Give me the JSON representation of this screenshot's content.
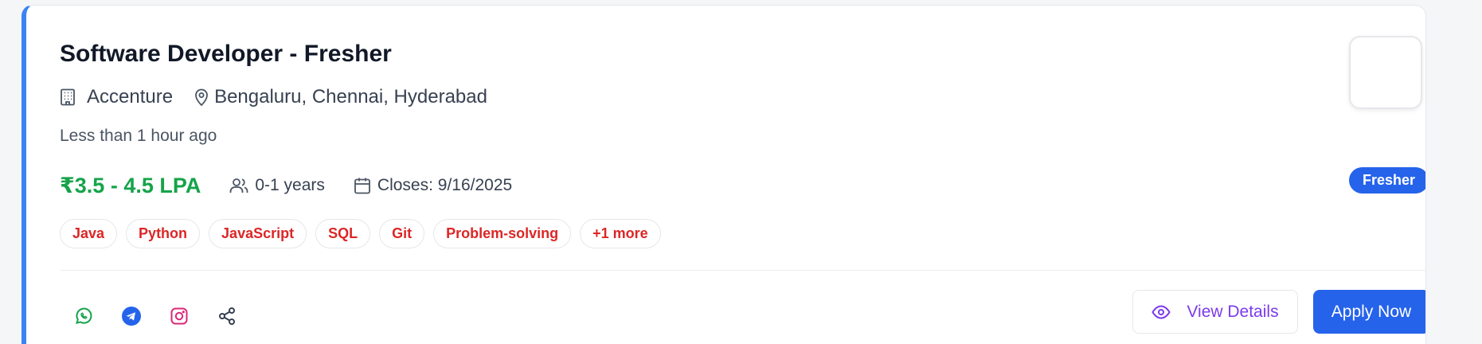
{
  "job": {
    "title": "Software Developer - Fresher",
    "company": "Accenture",
    "locations": "Bengaluru, Chennai, Hyderabad",
    "posted": "Less than 1 hour ago",
    "salary": "₹3.5 - 4.5 LPA",
    "experience": "0-1 years",
    "closes": "Closes: 9/16/2025",
    "level_badge": "Fresher",
    "skills": [
      "Java",
      "Python",
      "JavaScript",
      "SQL",
      "Git",
      "Problem-solving",
      "+1 more"
    ]
  },
  "actions": {
    "view_details": "View Details",
    "apply_now": "Apply Now"
  },
  "share": [
    {
      "name": "whatsapp-icon",
      "color": "#16a34a"
    },
    {
      "name": "telegram-icon",
      "color": "#2563eb"
    },
    {
      "name": "instagram-icon",
      "color": "#db2777"
    },
    {
      "name": "share-icon",
      "color": "#374151"
    }
  ],
  "colors": {
    "accent": "#3b82f6",
    "salary": "#16a34a",
    "tag_text": "#dc2626",
    "primary_button": "#2563eb",
    "view_details": "#7c3aed"
  }
}
